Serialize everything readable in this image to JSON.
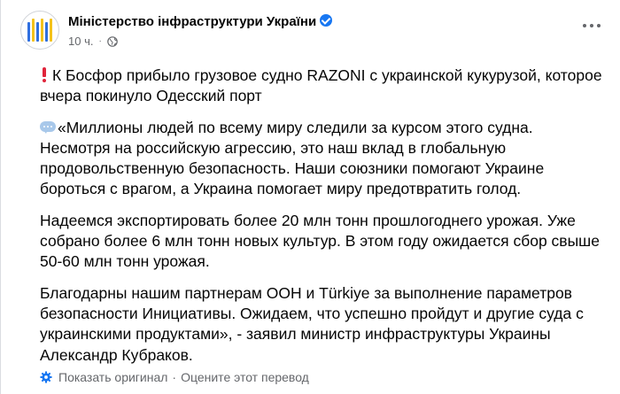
{
  "header": {
    "page_name": "Міністерство інфраструктури України",
    "time": "10 ч.",
    "dot": "·"
  },
  "icons": {
    "avatar": "ministry-logo-bars",
    "verified": "verified-badge-icon",
    "audience": "globe-icon",
    "more": "more-options-icon",
    "exclamation": "red-exclamation-emoji",
    "speech": "speech-bubble-emoji",
    "settings": "gear-icon"
  },
  "colors": {
    "accent": "#1877f2",
    "secondary_text": "#65676b",
    "exclamation": "#e0243a"
  },
  "post": {
    "para1": "К Босфор прибыло грузовое судно RAZONI с украинской кукурузой, которое вчера покинуло Одесский порт",
    "para2": "«Миллионы людей по всему миру следили за курсом этого судна. Несмотря на российскую агрессию, это наш вклад в глобальную продовольственную безопасность. Наши союзники помогают Украине бороться с врагом, а Украина помогает миру предотвратить голод.",
    "para3": "Надеемся экспортировать более 20 млн тонн прошлогоднего урожая. Уже собрано более 6 млн тонн новых культур. В этом году ожидается сбор свыше 50-60 млн тонн урожая.",
    "para4": "Благодарны нашим партнерам ООН и Türkiye за выполнение параметров безопасности Инициативы. Ожидаем, что успешно пройдут и другие суда с украинскими продуктами», - заявил министр инфраструктуры Украины Александр Кубраков."
  },
  "translation": {
    "show_original": "Показать оригинал",
    "separator": "·",
    "rate": "Оцените этот перевод"
  }
}
